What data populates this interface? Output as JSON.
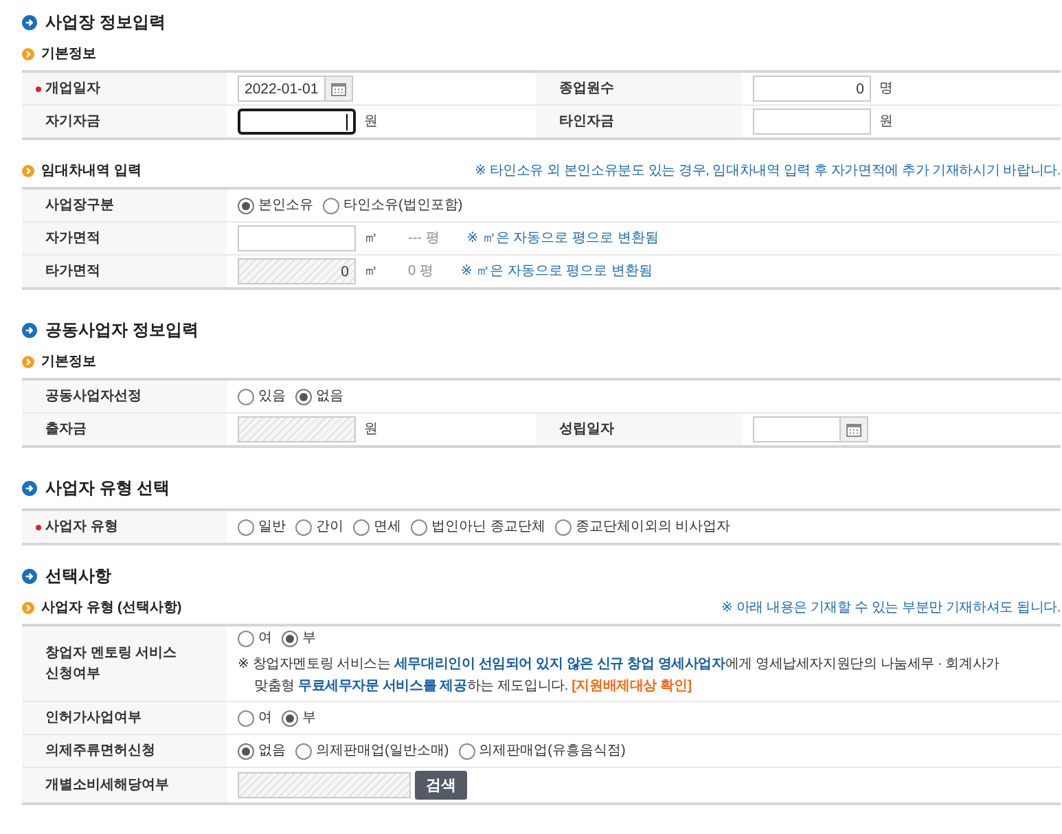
{
  "sections": [
    {
      "title": "사업장 정보입력",
      "blocks": [
        {
          "subtitle": "기본정보",
          "rows": [
            {
              "cells": [
                {
                  "label": "개업일자",
                  "required": true,
                  "items": [
                    {
                      "kind": "date",
                      "value": "2022-01-01",
                      "disabled": false,
                      "focused": false
                    }
                  ]
                },
                {
                  "label": "종업원수",
                  "required": false,
                  "items": [
                    {
                      "kind": "input",
                      "value": "0",
                      "disabled": false,
                      "focused": false
                    },
                    {
                      "kind": "unit",
                      "text": "명"
                    }
                  ]
                }
              ]
            },
            {
              "cells": [
                {
                  "label": "자기자금",
                  "required": false,
                  "items": [
                    {
                      "kind": "input",
                      "disabled": false,
                      "focused": true
                    },
                    {
                      "kind": "unit",
                      "text": "원"
                    }
                  ]
                },
                {
                  "label": "타인자금",
                  "required": false,
                  "items": [
                    {
                      "kind": "input",
                      "disabled": false,
                      "focused": false
                    },
                    {
                      "kind": "unit",
                      "text": "원"
                    }
                  ]
                }
              ]
            }
          ]
        },
        {
          "subtitle": "임대차내역 입력",
          "note": "※ 타인소유 외 본인소유분도 있는 경우, 임대차내역 입력 후 자가면적에 추가 기재하시기 바랍니다.",
          "rows": [
            {
              "cells": [
                {
                  "label": "사업장구분",
                  "required": false,
                  "items": [
                    {
                      "kind": "radios",
                      "options": [
                        {
                          "label": "본인소유",
                          "selected": true
                        },
                        {
                          "label": "타인소유(법인포함)",
                          "selected": false
                        }
                      ]
                    }
                  ]
                }
              ]
            },
            {
              "cells": [
                {
                  "label": "자가면적",
                  "required": false,
                  "items": [
                    {
                      "kind": "input",
                      "disabled": false,
                      "focused": false
                    },
                    {
                      "kind": "unit",
                      "text": "㎡"
                    },
                    {
                      "kind": "converted",
                      "text": "--- 평"
                    },
                    {
                      "kind": "hint",
                      "text": "※ ㎡은 자동으로 평으로 변환됨"
                    }
                  ]
                }
              ]
            },
            {
              "cells": [
                {
                  "label": "타가면적",
                  "required": false,
                  "items": [
                    {
                      "kind": "input",
                      "value": "0",
                      "disabled": true,
                      "focused": false
                    },
                    {
                      "kind": "unit",
                      "text": "㎡"
                    },
                    {
                      "kind": "converted",
                      "text": "0 평"
                    },
                    {
                      "kind": "hint",
                      "text": "※ ㎡은 자동으로 평으로 변환됨"
                    }
                  ]
                }
              ]
            }
          ]
        }
      ]
    },
    {
      "title": "공동사업자 정보입력",
      "blocks": [
        {
          "subtitle": "기본정보",
          "rows": [
            {
              "cells": [
                {
                  "label": "공동사업자선정",
                  "required": false,
                  "items": [
                    {
                      "kind": "radios",
                      "options": [
                        {
                          "label": "있음",
                          "selected": false
                        },
                        {
                          "label": "없음",
                          "selected": true
                        }
                      ]
                    }
                  ]
                }
              ]
            },
            {
              "cells": [
                {
                  "label": "출자금",
                  "required": false,
                  "items": [
                    {
                      "kind": "input",
                      "disabled": true,
                      "focused": false
                    },
                    {
                      "kind": "unit",
                      "text": "원"
                    }
                  ]
                },
                {
                  "label": "성립일자",
                  "required": false,
                  "items": [
                    {
                      "kind": "date",
                      "disabled": false,
                      "focused": false
                    }
                  ]
                }
              ]
            }
          ]
        }
      ]
    },
    {
      "title": "사업자 유형 선택",
      "blocks": [
        {
          "rows": [
            {
              "cells": [
                {
                  "label": "사업자 유형",
                  "required": true,
                  "items": [
                    {
                      "kind": "radios",
                      "options": [
                        {
                          "label": "일반",
                          "selected": false
                        },
                        {
                          "label": "간이",
                          "selected": false
                        },
                        {
                          "label": "면세",
                          "selected": false
                        },
                        {
                          "label": "법인아닌 종교단체",
                          "selected": false
                        },
                        {
                          "label": "종교단체이외의 비사업자",
                          "selected": false
                        }
                      ]
                    }
                  ]
                }
              ]
            }
          ]
        }
      ]
    },
    {
      "title": "선택사항",
      "blocks": [
        {
          "subtitle": "사업자 유형 (선택사항)",
          "note": "※ 아래 내용은 기재할 수 있는 부분만 기재하셔도 됩니다.",
          "rows": [
            {
              "cells": [
                {
                  "label": "창업자 멘토링 서비스 신청여부",
                  "required": false,
                  "items": [
                    {
                      "kind": "radios",
                      "options": [
                        {
                          "label": "여",
                          "selected": false
                        },
                        {
                          "label": "부",
                          "selected": true
                        }
                      ]
                    },
                    {
                      "kind": "notice",
                      "text": "※ 창업자멘토링 서비스는 **세무대리인이 선임되어 있지 않은 신규 창업 영세사업자**에게 영세납세자지원단의 나눔세무 · 회계사가 맞춤형 **무료세무자문 서비스를 제공**하는 제도입니다.",
                      "link": "[지원배제대상 확인]"
                    }
                  ]
                }
              ]
            },
            {
              "cells": [
                {
                  "label": "인허가사업여부",
                  "required": false,
                  "items": [
                    {
                      "kind": "radios",
                      "options": [
                        {
                          "label": "여",
                          "selected": false
                        },
                        {
                          "label": "부",
                          "selected": true
                        }
                      ]
                    }
                  ]
                }
              ]
            },
            {
              "cells": [
                {
                  "label": "의제주류면허신청",
                  "required": false,
                  "items": [
                    {
                      "kind": "radios",
                      "options": [
                        {
                          "label": "없음",
                          "selected": true
                        },
                        {
                          "label": "의제판매업(일반소매)",
                          "selected": false
                        },
                        {
                          "label": "의제판매업(유흥음식점)",
                          "selected": false
                        }
                      ]
                    }
                  ]
                }
              ]
            },
            {
              "cells": [
                {
                  "label": "개별소비세해당여부",
                  "required": false,
                  "items": [
                    {
                      "kind": "lookup",
                      "disabled": true,
                      "focused": false,
                      "button": "검색"
                    }
                  ]
                }
              ]
            }
          ]
        }
      ]
    }
  ]
}
